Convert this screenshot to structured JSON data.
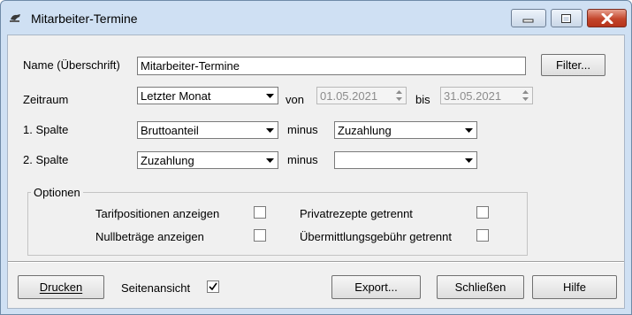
{
  "window": {
    "title": "Mitarbeiter-Termine",
    "minimize_icon": "minimize-icon",
    "maximize_icon": "maximize-icon",
    "close_icon": "close-icon"
  },
  "form": {
    "name_label": "Name (Überschrift)",
    "name_value": "Mitarbeiter-Termine",
    "filter_button": "Filter...",
    "zeitraum_label": "Zeitraum",
    "zeitraum_value": "Letzter Monat",
    "von_label": "von",
    "von_value": "01.05.2021",
    "bis_label": "bis",
    "bis_value": "31.05.2021",
    "spalte1_label": "1. Spalte",
    "spalte1_value": "Bruttoanteil",
    "spalte1_minus_label": "minus",
    "spalte1_minus_value": "Zuzahlung",
    "spalte2_label": "2. Spalte",
    "spalte2_value": "Zuzahlung",
    "spalte2_minus_label": "minus",
    "spalte2_minus_value": ""
  },
  "options": {
    "group_title": "Optionen",
    "tarif_label": "Tarifpositionen anzeigen",
    "tarif_checked": false,
    "privat_label": "Privatrezepte getrennt",
    "privat_checked": false,
    "null_label": "Nullbeträge anzeigen",
    "null_checked": false,
    "uebermittlung_label": "Übermittlungsgebühr getrennt",
    "uebermittlung_checked": false
  },
  "footer": {
    "drucken_button": "Drucken",
    "seitenansicht_label": "Seitenansicht",
    "seitenansicht_checked": true,
    "export_button": "Export...",
    "schliessen_button": "Schließen",
    "hilfe_button": "Hilfe"
  }
}
